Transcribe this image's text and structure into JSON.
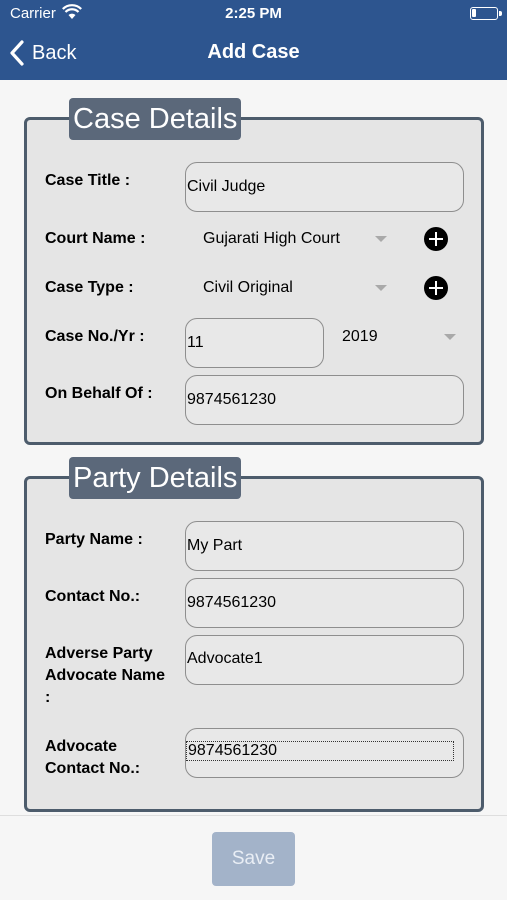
{
  "status": {
    "carrier": "Carrier",
    "time": "2:25 PM"
  },
  "nav": {
    "back_label": "Back",
    "title": "Add Case"
  },
  "case_details": {
    "title": "Case Details",
    "case_title_label": "Case Title :",
    "case_title_value": "Civil Judge",
    "court_name_label": "Court Name :",
    "court_name_value": "Gujarati High Court",
    "case_type_label": "Case Type :",
    "case_type_value": "Civil Original",
    "case_no_label": "Case No./Yr :",
    "case_no_value": "11",
    "year_value": "2019",
    "on_behalf_label": "On Behalf Of :",
    "on_behalf_value": "9874561230"
  },
  "party_details": {
    "title": "Party Details",
    "party_name_label": "Party Name :",
    "party_name_value": "My Part",
    "contact_label": "Contact No.:",
    "contact_value": "9874561230",
    "adverse_label_line1": "Adverse Party",
    "adverse_label_line2": "Advocate Name",
    "adverse_label_line3": ":",
    "adverse_value": "Advocate1",
    "advocate_contact_label_line1": "Advocate",
    "advocate_contact_label_line2": "Contact No.:",
    "advocate_contact_value": "9874561230"
  },
  "footer": {
    "save_label": "Save"
  },
  "colors": {
    "nav_bar": "#2d558f",
    "panel_title_bg": "#5b687a",
    "panel_border": "#4d5c6c",
    "save_button": "#a3b3c9"
  },
  "icons": [
    "wifi-icon",
    "battery-icon",
    "back-chevron-icon",
    "dropdown-caret-icon",
    "add-circle-icon"
  ]
}
